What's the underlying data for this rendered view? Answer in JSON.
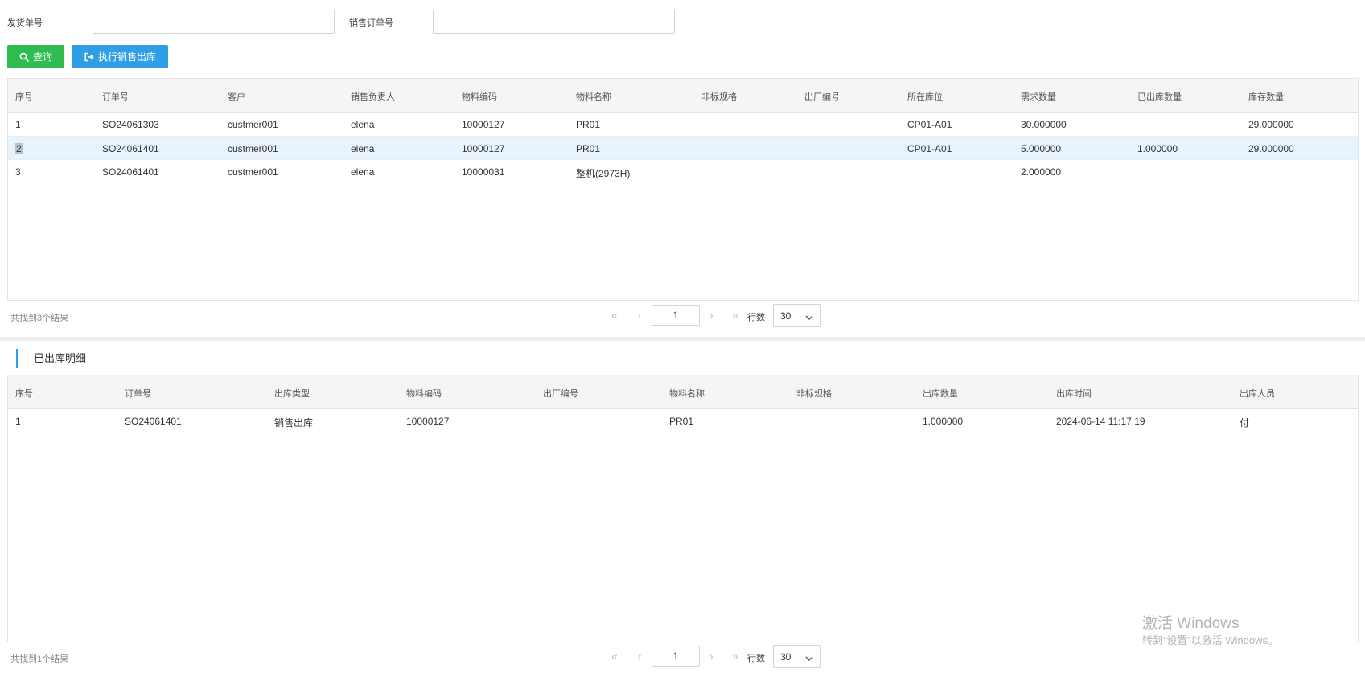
{
  "search": {
    "shipment_no_label": "发货单号",
    "shipment_no_value": "",
    "sales_order_label": "销售订单号",
    "sales_order_value": ""
  },
  "toolbar": {
    "query_label": "查询",
    "exec_label": "执行销售出库"
  },
  "orders_table": {
    "columns": [
      "序号",
      "订单号",
      "客户",
      "销售负责人",
      "物料编码",
      "物料名称",
      "非标规格",
      "出厂编号",
      "所在库位",
      "需求数量",
      "已出库数量",
      "库存数量"
    ],
    "rows": [
      [
        "1",
        "SO24061303",
        "custmer001",
        "elena",
        "10000127",
        "PR01",
        "",
        "",
        "CP01-A01",
        "30.000000",
        "",
        "29.000000"
      ],
      [
        "2",
        "SO24061401",
        "custmer001",
        "elena",
        "10000127",
        "PR01",
        "",
        "",
        "CP01-A01",
        "5.000000",
        "1.000000",
        "29.000000"
      ],
      [
        "3",
        "SO24061401",
        "custmer001",
        "elena",
        "10000031",
        "整机(2973H)",
        "",
        "",
        "",
        "2.000000",
        "",
        ""
      ]
    ],
    "selected_row": 2
  },
  "orders_pager": {
    "count_text": "共找到3个结果",
    "first": "«",
    "prev": "‹",
    "page": "1",
    "next": "›",
    "last": "»",
    "rows_label": "行数",
    "rows_value": "30"
  },
  "detail_section": {
    "title": "已出库明细"
  },
  "detail_table": {
    "columns": [
      "序号",
      "订单号",
      "出库类型",
      "物料编码",
      "出厂编号",
      "物料名称",
      "非标规格",
      "出库数量",
      "出库时间",
      "出库人员"
    ],
    "rows": [
      [
        "1",
        "SO24061401",
        "销售出库",
        "10000127",
        "",
        "PR01",
        "",
        "1.000000",
        "2024-06-14 11:17:19",
        "付"
      ]
    ]
  },
  "detail_pager": {
    "count_text": "共找到1个结果",
    "first": "«",
    "prev": "‹",
    "page": "1",
    "next": "›",
    "last": "»",
    "rows_label": "行数",
    "rows_value": "30"
  },
  "watermark": {
    "line1": "激活 Windows",
    "line2": "转到“设置”以激活 Windows。"
  },
  "colors": {
    "query_button": "#2fbd52",
    "exec_button": "#2e9fe7",
    "selected_row": "#e8f4fd",
    "header_bg": "#f5f5f5"
  },
  "icons": {
    "query_button": "search-icon",
    "exec_button": "sign-out-icon",
    "rows_select": "chevron-down-icon"
  }
}
